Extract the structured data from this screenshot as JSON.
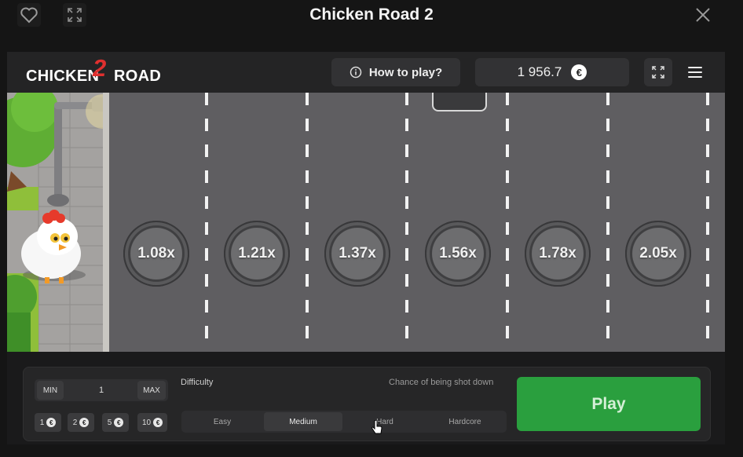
{
  "window": {
    "title": "Chicken Road 2"
  },
  "header": {
    "logo_left": "CHICKEN",
    "logo_num": "2",
    "logo_right": "ROAD",
    "how_to_play": "How to play?",
    "balance": "1 956.7",
    "currency": "€"
  },
  "multipliers": [
    "1.08x",
    "1.21x",
    "1.37x",
    "1.56x",
    "1.78x",
    "2.05x"
  ],
  "bet": {
    "min_label": "MIN",
    "value": "1",
    "max_label": "MAX",
    "quick": [
      "1",
      "2",
      "5",
      "10"
    ]
  },
  "difficulty": {
    "label": "Difficulty",
    "chance_label": "Chance of being shot down",
    "options": [
      "Easy",
      "Medium",
      "Hard",
      "Hardcore"
    ],
    "selected": "Medium"
  },
  "play_label": "Play",
  "colors": {
    "play": "#2a9f3e",
    "logo_accent": "#e0302f",
    "road": "#5f5e61"
  },
  "icons": [
    "heart-icon",
    "expand-icon",
    "close-icon",
    "info-icon",
    "euro-icon",
    "fullscreen-icon",
    "menu-icon"
  ]
}
